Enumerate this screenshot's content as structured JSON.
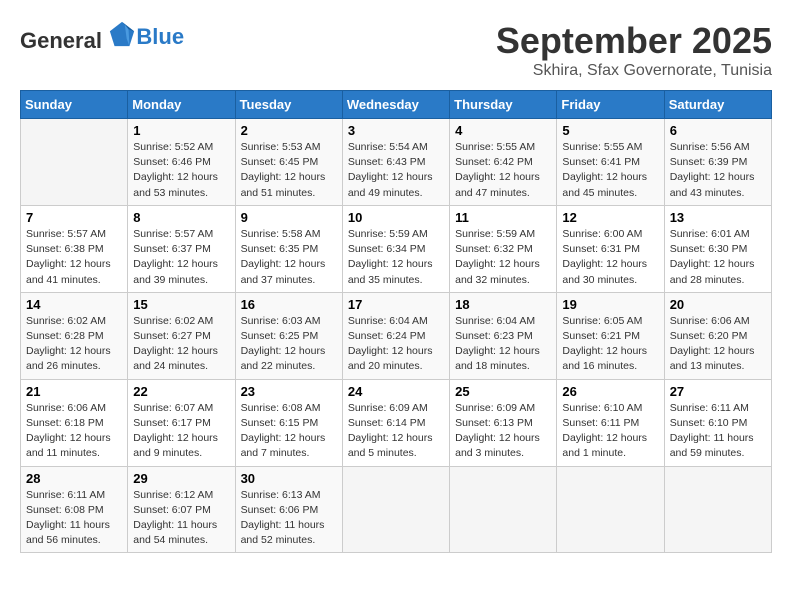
{
  "logo": {
    "general": "General",
    "blue": "Blue"
  },
  "header": {
    "month": "September 2025",
    "location": "Skhira, Sfax Governorate, Tunisia"
  },
  "days": [
    "Sunday",
    "Monday",
    "Tuesday",
    "Wednesday",
    "Thursday",
    "Friday",
    "Saturday"
  ],
  "weeks": [
    [
      {
        "day": "",
        "info": ""
      },
      {
        "day": "1",
        "info": "Sunrise: 5:52 AM\nSunset: 6:46 PM\nDaylight: 12 hours\nand 53 minutes."
      },
      {
        "day": "2",
        "info": "Sunrise: 5:53 AM\nSunset: 6:45 PM\nDaylight: 12 hours\nand 51 minutes."
      },
      {
        "day": "3",
        "info": "Sunrise: 5:54 AM\nSunset: 6:43 PM\nDaylight: 12 hours\nand 49 minutes."
      },
      {
        "day": "4",
        "info": "Sunrise: 5:55 AM\nSunset: 6:42 PM\nDaylight: 12 hours\nand 47 minutes."
      },
      {
        "day": "5",
        "info": "Sunrise: 5:55 AM\nSunset: 6:41 PM\nDaylight: 12 hours\nand 45 minutes."
      },
      {
        "day": "6",
        "info": "Sunrise: 5:56 AM\nSunset: 6:39 PM\nDaylight: 12 hours\nand 43 minutes."
      }
    ],
    [
      {
        "day": "7",
        "info": "Sunrise: 5:57 AM\nSunset: 6:38 PM\nDaylight: 12 hours\nand 41 minutes."
      },
      {
        "day": "8",
        "info": "Sunrise: 5:57 AM\nSunset: 6:37 PM\nDaylight: 12 hours\nand 39 minutes."
      },
      {
        "day": "9",
        "info": "Sunrise: 5:58 AM\nSunset: 6:35 PM\nDaylight: 12 hours\nand 37 minutes."
      },
      {
        "day": "10",
        "info": "Sunrise: 5:59 AM\nSunset: 6:34 PM\nDaylight: 12 hours\nand 35 minutes."
      },
      {
        "day": "11",
        "info": "Sunrise: 5:59 AM\nSunset: 6:32 PM\nDaylight: 12 hours\nand 32 minutes."
      },
      {
        "day": "12",
        "info": "Sunrise: 6:00 AM\nSunset: 6:31 PM\nDaylight: 12 hours\nand 30 minutes."
      },
      {
        "day": "13",
        "info": "Sunrise: 6:01 AM\nSunset: 6:30 PM\nDaylight: 12 hours\nand 28 minutes."
      }
    ],
    [
      {
        "day": "14",
        "info": "Sunrise: 6:02 AM\nSunset: 6:28 PM\nDaylight: 12 hours\nand 26 minutes."
      },
      {
        "day": "15",
        "info": "Sunrise: 6:02 AM\nSunset: 6:27 PM\nDaylight: 12 hours\nand 24 minutes."
      },
      {
        "day": "16",
        "info": "Sunrise: 6:03 AM\nSunset: 6:25 PM\nDaylight: 12 hours\nand 22 minutes."
      },
      {
        "day": "17",
        "info": "Sunrise: 6:04 AM\nSunset: 6:24 PM\nDaylight: 12 hours\nand 20 minutes."
      },
      {
        "day": "18",
        "info": "Sunrise: 6:04 AM\nSunset: 6:23 PM\nDaylight: 12 hours\nand 18 minutes."
      },
      {
        "day": "19",
        "info": "Sunrise: 6:05 AM\nSunset: 6:21 PM\nDaylight: 12 hours\nand 16 minutes."
      },
      {
        "day": "20",
        "info": "Sunrise: 6:06 AM\nSunset: 6:20 PM\nDaylight: 12 hours\nand 13 minutes."
      }
    ],
    [
      {
        "day": "21",
        "info": "Sunrise: 6:06 AM\nSunset: 6:18 PM\nDaylight: 12 hours\nand 11 minutes."
      },
      {
        "day": "22",
        "info": "Sunrise: 6:07 AM\nSunset: 6:17 PM\nDaylight: 12 hours\nand 9 minutes."
      },
      {
        "day": "23",
        "info": "Sunrise: 6:08 AM\nSunset: 6:15 PM\nDaylight: 12 hours\nand 7 minutes."
      },
      {
        "day": "24",
        "info": "Sunrise: 6:09 AM\nSunset: 6:14 PM\nDaylight: 12 hours\nand 5 minutes."
      },
      {
        "day": "25",
        "info": "Sunrise: 6:09 AM\nSunset: 6:13 PM\nDaylight: 12 hours\nand 3 minutes."
      },
      {
        "day": "26",
        "info": "Sunrise: 6:10 AM\nSunset: 6:11 PM\nDaylight: 12 hours\nand 1 minute."
      },
      {
        "day": "27",
        "info": "Sunrise: 6:11 AM\nSunset: 6:10 PM\nDaylight: 11 hours\nand 59 minutes."
      }
    ],
    [
      {
        "day": "28",
        "info": "Sunrise: 6:11 AM\nSunset: 6:08 PM\nDaylight: 11 hours\nand 56 minutes."
      },
      {
        "day": "29",
        "info": "Sunrise: 6:12 AM\nSunset: 6:07 PM\nDaylight: 11 hours\nand 54 minutes."
      },
      {
        "day": "30",
        "info": "Sunrise: 6:13 AM\nSunset: 6:06 PM\nDaylight: 11 hours\nand 52 minutes."
      },
      {
        "day": "",
        "info": ""
      },
      {
        "day": "",
        "info": ""
      },
      {
        "day": "",
        "info": ""
      },
      {
        "day": "",
        "info": ""
      }
    ]
  ]
}
